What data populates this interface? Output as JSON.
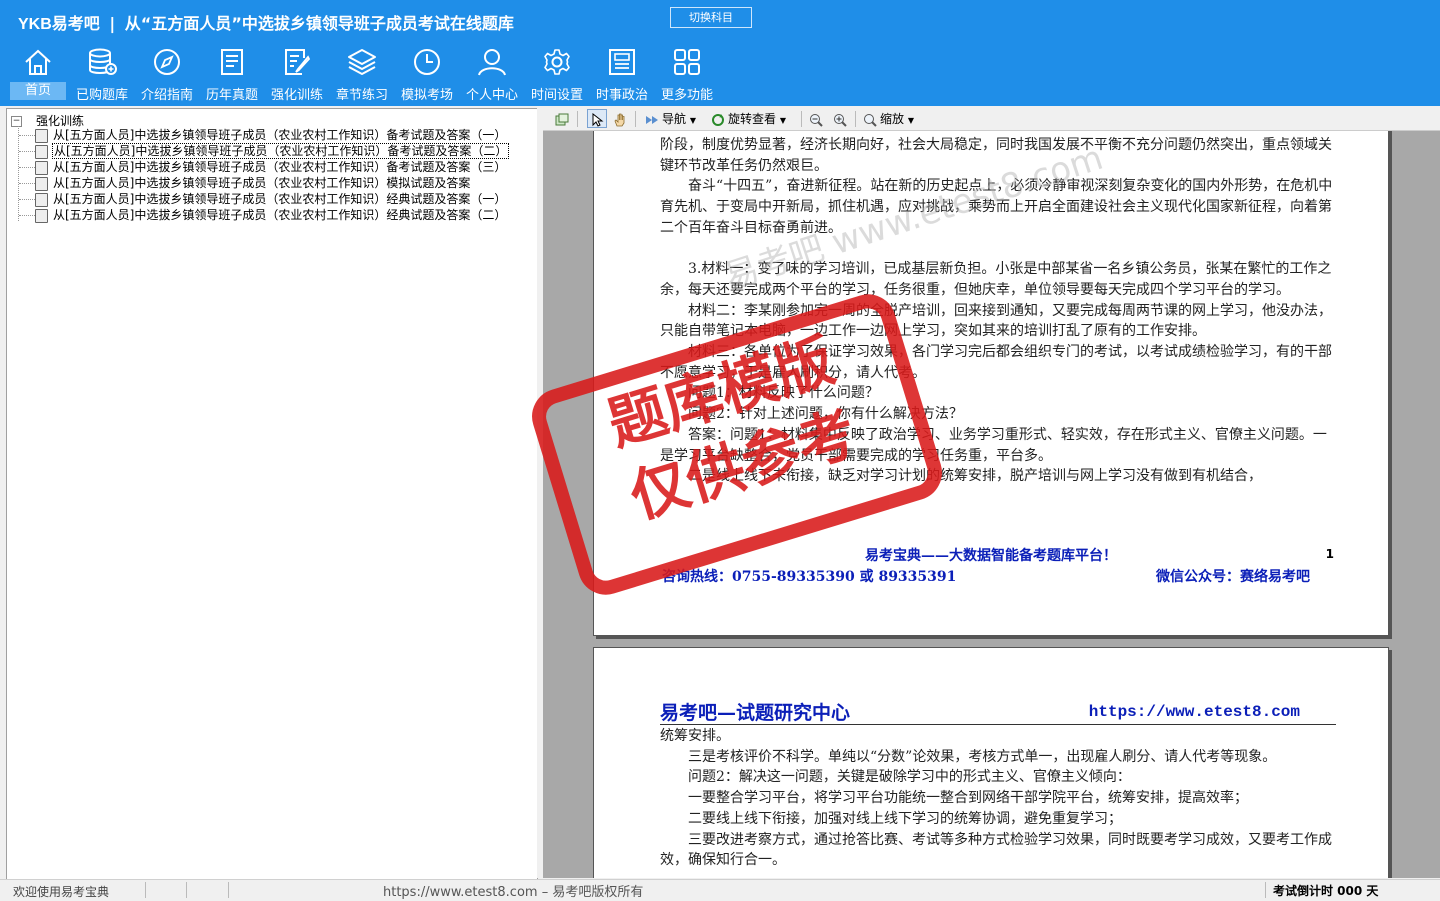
{
  "header": {
    "logo": "YKB易考吧",
    "separator": "|",
    "title": "从“五方面人员”中选拔乡镇领导班子成员考试在线题库",
    "switch_label": "切换科目"
  },
  "toolbar": [
    {
      "label": "首页",
      "icon": "home-icon"
    },
    {
      "label": "已购题库",
      "icon": "database-icon"
    },
    {
      "label": "介绍指南",
      "icon": "compass-icon"
    },
    {
      "label": "历年真题",
      "icon": "document-list-icon"
    },
    {
      "label": "强化训练",
      "icon": "edit-icon"
    },
    {
      "label": "章节练习",
      "icon": "layers-icon"
    },
    {
      "label": "模拟考场",
      "icon": "clock-icon"
    },
    {
      "label": "个人中心",
      "icon": "user-icon"
    },
    {
      "label": "时间设置",
      "icon": "gear-icon"
    },
    {
      "label": "时事政治",
      "icon": "newspaper-icon"
    },
    {
      "label": "更多功能",
      "icon": "grid-icon"
    }
  ],
  "tree": {
    "root_label": "强化训练",
    "items": [
      "从[五方面人员]中选拔乡镇领导班子成员（农业农村工作知识）备考试题及答案（一）",
      "从[五方面人员]中选拔乡镇领导班子成员（农业农村工作知识）备考试题及答案（二）",
      "从[五方面人员]中选拔乡镇领导班子成员（农业农村工作知识）备考试题及答案（三）",
      "从[五方面人员]中选拔乡镇领导班子成员（农业农村工作知识）模拟试题及答案",
      "从[五方面人员]中选拔乡镇领导班子成员（农业农村工作知识）经典试题及答案（一）",
      "从[五方面人员]中选拔乡镇领导班子成员（农业农村工作知识）经典试题及答案（二）"
    ],
    "selected_index": 1
  },
  "viewer_toolbar": {
    "nav_label": "导航",
    "rotate_label": "旋转查看",
    "zoom_label": "缩放"
  },
  "page1": {
    "paragraphs": [
      {
        "text": "阶段，制度优势显著，经济长期向好，社会大局稳定，同时我国发展不平衡不充分问题仍然突出，重点领域关键环节改革任务仍然艰巨。",
        "indent": false
      },
      {
        "text": "奋斗“十四五”，奋进新征程。站在新的历史起点上，必须冷静审视深刻复杂变化的国内外形势，在危机中育先机、于变局中开新局，抓住机遇，应对挑战，乘势而上开启全面建设社会主义现代化国家新征程，向着第二个百年奋斗目标奋勇前进。",
        "indent": true
      },
      {
        "text": "3.材料一：变了味的学习培训，已成基层新负担。小张是中部某省一名乡镇公务员，张某在繁忙的工作之余，每天还要完成两个平台的学习，任务很重，但她庆幸，单位领导要每天完成四个学习平台的学习。",
        "indent": true
      },
      {
        "text": "材料二：李某刚参加完一周的全脱产培训，回来接到通知，又要完成每周两节课的网上学习，他没办法，只能自带笔记本电脑，一边工作一边网上学习，突如其来的培训打乱了原有的工作安排。",
        "indent": true
      },
      {
        "text": "材料三：各单位为了保证学习效果，各门学习完后都会组织专门的考试，以考试成绩检验学习，有的干部不愿意学习，于是雇人刷积分，请人代考。",
        "indent": true
      },
      {
        "text": "问题1：材料反映了什么问题？",
        "indent": true
      },
      {
        "text": "问题2：针对上述问题，你有什么解决方法？",
        "indent": true
      },
      {
        "text": "答案：问题1：材料集中反映了政治学习、业务学习重形式、轻实效，存在形式主义、官僚主义问题。一是学习平台缺整合，党员干部需要完成的学习任务重，平台多。",
        "indent": true
      },
      {
        "text": "二是线上线下未衔接，缺乏对学习计划的统筹安排，脱产培训与网上学习没有做到有机结合，",
        "indent": true
      }
    ],
    "footer_slogan": "易考宝典——大数据智能备考题库平台！",
    "page_number": "1",
    "hotline": "咨询热线：0755-89335390 或 89335391",
    "wechat": "微信公众号：赛络易考吧"
  },
  "page2": {
    "header_title": "易考吧—试题研究中心",
    "header_url": "https://www.etest8.com",
    "paragraphs": [
      {
        "text": "统筹安排。",
        "indent": false
      },
      {
        "text": "三是考核评价不科学。单纯以“分数”论效果，考核方式单一，出现雇人刷分、请人代考等现象。",
        "indent": true
      },
      {
        "text": "问题2：解决这一问题，关键是破除学习中的形式主义、官僚主义倾向：",
        "indent": true
      },
      {
        "text": "一要整合学习平台，将学习平台功能统一整合到网络干部学院平台，统筹安排，提高效率；",
        "indent": true
      },
      {
        "text": "二要线上线下衔接，加强对线上线下学习的统筹协调，避免重复学习；",
        "indent": true
      },
      {
        "text": "三要改进考察方式，通过抢答比赛、考试等多种方式检验学习效果，同时既要考学习成效，又要考工作成效，确保知行合一。",
        "indent": true
      }
    ]
  },
  "stamp": {
    "line1": "题库模版",
    "line2": "仅供参考",
    "color": "#d91a1a"
  },
  "watermark": "易考吧 www.etest8.com",
  "statusbar": {
    "left": "欢迎使用易考宝典",
    "center": "https://www.etest8.com – 易考吧版权所有",
    "right": "考试倒计时 000 天"
  },
  "colors": {
    "header_bg": "#1f8ee8",
    "link_blue": "#0b1fb8",
    "stamp_red": "#d91a1a"
  }
}
